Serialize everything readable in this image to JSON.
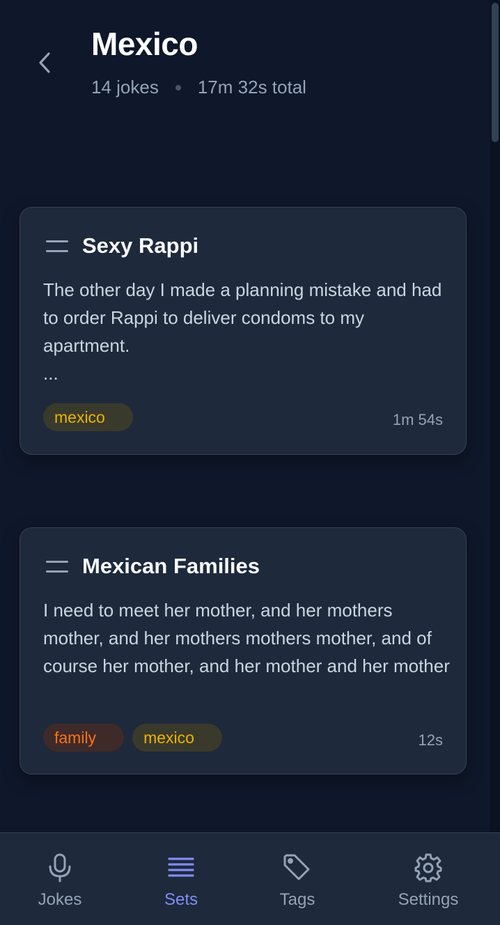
{
  "header": {
    "title": "Mexico",
    "joke_count": "14 jokes",
    "total_time": "17m 32s total"
  },
  "jokes": [
    {
      "title": "Sexy Rappi",
      "body": "The other day I made a planning mistake and had to order Rappi to deliver condoms to my apartment.\n...",
      "tags": [
        "mexico"
      ],
      "duration": "1m 54s"
    },
    {
      "title": "Mexican Families",
      "body": "I need to meet her mother, and her mothers mother, and her mothers mothers mother, and of course her mother, and her mother and her mother",
      "tags": [
        "family",
        "mexico"
      ],
      "duration": "12s"
    }
  ],
  "nav": {
    "items": [
      {
        "label": "Jokes",
        "icon": "microphone-icon"
      },
      {
        "label": "Sets",
        "icon": "list-icon",
        "active": true
      },
      {
        "label": "Tags",
        "icon": "tag-icon"
      },
      {
        "label": "Settings",
        "icon": "gear-icon"
      }
    ]
  },
  "colors": {
    "background": "#0f172a",
    "card": "#1e293b",
    "accent": "#818cf8",
    "tag_mexico": "#eab308",
    "tag_family": "#f97316"
  }
}
